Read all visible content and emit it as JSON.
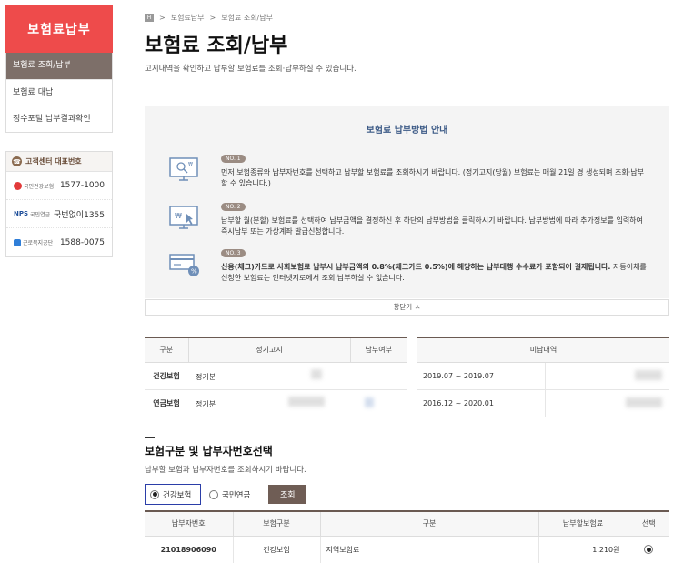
{
  "sidebar": {
    "title": "보험료납부",
    "items": [
      {
        "label": "보험료 조회/납부"
      },
      {
        "label": "보험료 대납"
      },
      {
        "label": "징수포털 납부결과확인"
      }
    ]
  },
  "contact": {
    "title": "고객센터 대표번호",
    "rows": [
      {
        "org": "국민건강보험",
        "number": "1577-1000"
      },
      {
        "org": "국민연금",
        "number": "국번없이1355"
      },
      {
        "org": "근로복지공단",
        "number": "1588-0075"
      }
    ]
  },
  "breadcrumb": {
    "home": "H",
    "items": [
      "보험료납부",
      "보험료 조회/납부"
    ]
  },
  "page": {
    "title": "보험료 조회/납부",
    "subtitle": "고지내역을 확인하고 납부할 보험료를 조회·납부하실 수 있습니다."
  },
  "guide": {
    "title": "보험료 납부방법 안내",
    "steps": [
      {
        "no": "NO. 1",
        "text": "먼저 보험종류와 납부자번호를 선택하고 납부할 보험료를 조회하시기 바랍니다. (정기고지(당월) 보험료는 매월 21일 경 생성되며 조회·납부할 수 있습니다.)",
        "icon": "monitor-search-icon"
      },
      {
        "no": "NO. 2",
        "text": "납부할 월(분할) 보험료를 선택하여 납부금액을 결정하신 후 하단의 납부방법을 클릭하시기 바랍니다. 납부방법에 따라 추가정보를 입력하여 즉시납부 또는 가상계좌 발급신청합니다.",
        "icon": "monitor-click-icon"
      },
      {
        "no": "NO. 3",
        "text_bold": "신용(체크)카드로 사회보험료 납부시 납부금액의 0.8%(체크카드 0.5%)에 해당하는 납부대행 수수료가 포함되어 결제됩니다.",
        "text": " 자동이체를 신청한 보험료는 인터넷지로에서 조회·납부하실 수 없습니다.",
        "icon": "card-percent-icon"
      }
    ],
    "close_label": "창닫기 ㅅ"
  },
  "summary": {
    "headers": {
      "type": "구분",
      "regular": "정기고지",
      "paid": "납부여부",
      "unpaid": "미납내역"
    },
    "rows": [
      {
        "type": "건강보험",
        "regular": "정기분",
        "unpaid_period": "2019.07 ~ 2019.07"
      },
      {
        "type": "연금보험",
        "regular": "정기분",
        "unpaid_period": "2016.12 ~ 2020.01"
      }
    ]
  },
  "select_section": {
    "title": "보험구분 및 납부자번호선택",
    "subtitle": "납부할 보험과 납부자번호를 조회하시기 바랍니다.",
    "options": [
      {
        "label": "건강보험",
        "checked": true
      },
      {
        "label": "국민연금",
        "checked": false
      }
    ],
    "search_label": "조회"
  },
  "result": {
    "headers": [
      "납부자번호",
      "보험구분",
      "구분",
      "납부할보험료",
      "선택"
    ],
    "rows": [
      {
        "payer_no": "21018906090",
        "ins_type": "건강보험",
        "category": "지역보험료",
        "amount": "1,210원",
        "selected": true
      }
    ]
  },
  "colors": {
    "accent": "#ee4b4b",
    "brown": "#7d6f69",
    "guide_title": "#3c5a86"
  }
}
